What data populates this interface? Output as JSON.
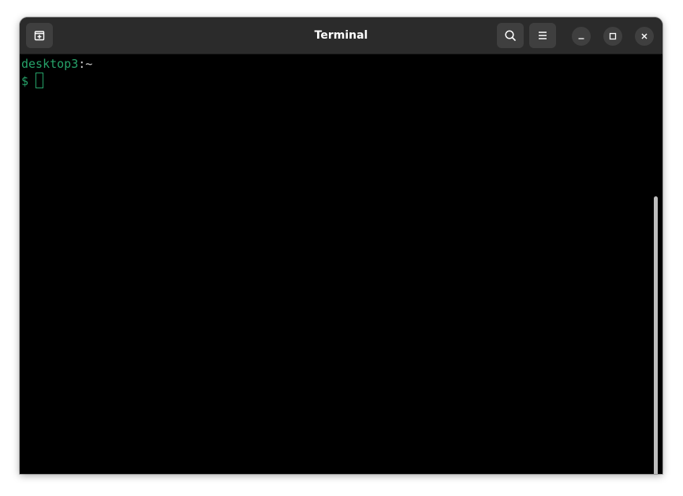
{
  "window": {
    "title": "Terminal"
  },
  "header": {
    "new_tab_icon": "new-tab-icon",
    "search_icon": "search-icon",
    "menu_icon": "hamburger-menu-icon",
    "minimize_icon": "minimize-icon",
    "maximize_icon": "maximize-icon",
    "close_icon": "close-icon"
  },
  "terminal": {
    "host": "desktop3",
    "separator": ":",
    "path": "~",
    "prompt_symbol": "$"
  },
  "colors": {
    "titlebar_bg": "#2b2b2b",
    "button_bg": "#3f3f3f",
    "terminal_bg": "#000000",
    "prompt_green": "#26a269",
    "text_color": "#d0d0d0"
  }
}
